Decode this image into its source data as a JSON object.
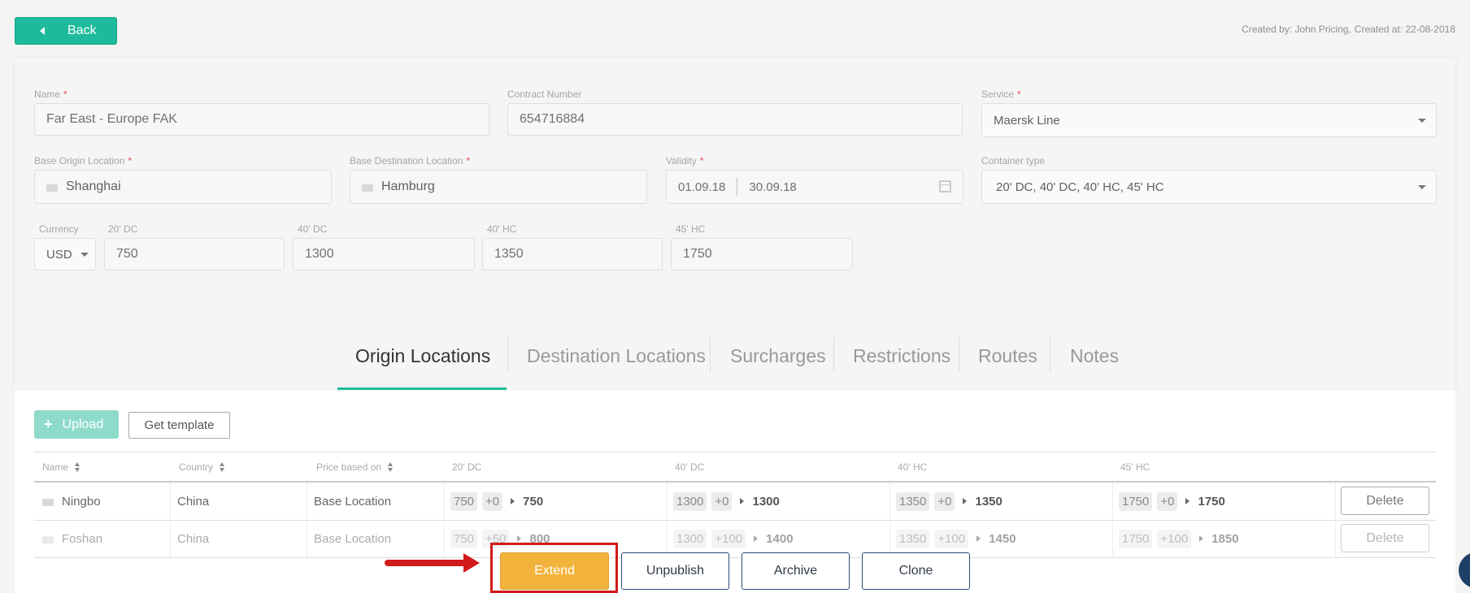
{
  "header": {
    "back_label": "Back",
    "created_by": "Created by: John Pricing,",
    "created_at": "Created at: 22-08-2018"
  },
  "form": {
    "name": {
      "label": "Name",
      "required": "*",
      "value": "Far East - Europe FAK"
    },
    "contract_number": {
      "label": "Contract Number",
      "value": "654716884"
    },
    "service": {
      "label": "Service",
      "required": "*",
      "value": "Maersk Line"
    },
    "base_origin": {
      "label": "Base Origin Location",
      "required": "*",
      "value": "Shanghai"
    },
    "base_destination": {
      "label": "Base Destination Location",
      "required": "*",
      "value": "Hamburg"
    },
    "validity": {
      "label": "Validity",
      "required": "*",
      "from": "01.09.18",
      "to": "30.09.18"
    },
    "container_type": {
      "label": "Container type",
      "value": "20' DC, 40' DC, 40' HC, 45' HC"
    },
    "currency": {
      "label": "Currency",
      "value": "USD"
    },
    "price_20dc": {
      "label": "20' DC",
      "value": "750"
    },
    "price_40dc": {
      "label": "40' DC",
      "value": "1300"
    },
    "price_40hc": {
      "label": "40' HC",
      "value": "1350"
    },
    "price_45hc": {
      "label": "45' HC",
      "value": "1750"
    }
  },
  "tabs": [
    {
      "label": "Origin Locations",
      "active": true
    },
    {
      "label": "Destination Locations"
    },
    {
      "label": "Surcharges"
    },
    {
      "label": "Restrictions"
    },
    {
      "label": "Routes"
    },
    {
      "label": "Notes"
    }
  ],
  "toolbar": {
    "upload_label": "Upload",
    "template_label": "Get template"
  },
  "table": {
    "columns": [
      "Name",
      "Country",
      "Price based on",
      "20' DC",
      "40' DC",
      "40' HC",
      "45' HC"
    ],
    "rows": [
      {
        "name": "Ningbo",
        "country": "China",
        "price_based_on": "Base Location",
        "prices": [
          {
            "base": "750",
            "delta": "+0",
            "total": "750"
          },
          {
            "base": "1300",
            "delta": "+0",
            "total": "1300"
          },
          {
            "base": "1350",
            "delta": "+0",
            "total": "1350"
          },
          {
            "base": "1750",
            "delta": "+0",
            "total": "1750"
          }
        ],
        "delete_label": "Delete"
      },
      {
        "name": "Foshan",
        "country": "China",
        "price_based_on": "Base Location",
        "prices": [
          {
            "base": "750",
            "delta": "+50",
            "total": "800"
          },
          {
            "base": "1300",
            "delta": "+100",
            "total": "1400"
          },
          {
            "base": "1350",
            "delta": "+100",
            "total": "1450"
          },
          {
            "base": "1750",
            "delta": "+100",
            "total": "1850"
          }
        ],
        "delete_label": "Delete"
      }
    ]
  },
  "actions": {
    "extend_label": "Extend",
    "unpublish_label": "Unpublish",
    "archive_label": "Archive",
    "clone_label": "Clone"
  },
  "colors": {
    "accent": "#1dbb9b",
    "extend": "#f2b33d",
    "highlight": "#d11a1a",
    "action_border": "#2e4a7a"
  }
}
